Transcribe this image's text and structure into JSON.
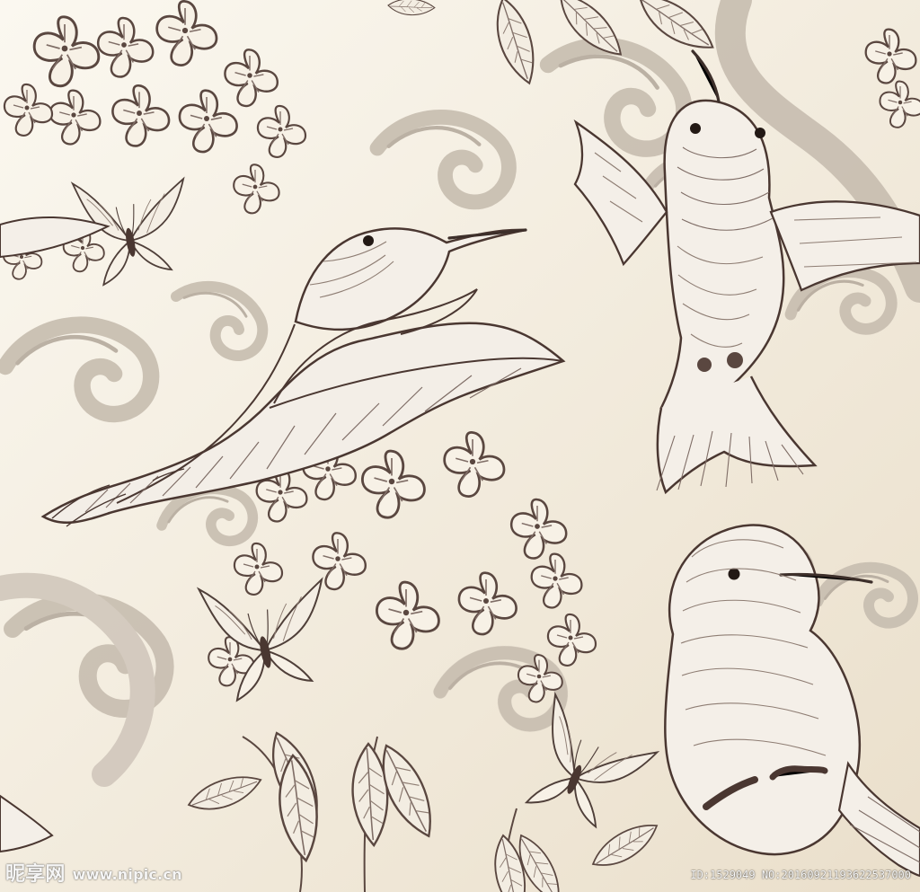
{
  "image": {
    "watermark_left_brand": "昵享网",
    "watermark_left_site": "www.nipic.cn",
    "watermark_right_text": "ID:1529049 NO:20160921193622537000"
  },
  "colors": {
    "paper": "#f2ebda",
    "ink": "#4b3a34",
    "ink_light": "#8e7d73",
    "ornament": "#c9bfb2",
    "ornament_dark": "#b8ada1"
  }
}
